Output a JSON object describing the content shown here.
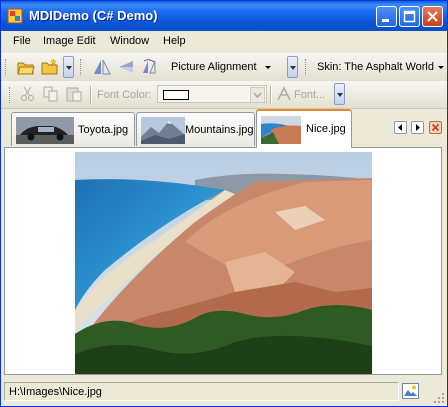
{
  "window": {
    "title": "MDIDemo (C# Demo)"
  },
  "menu": [
    "File",
    "Image Edit",
    "Window",
    "Help"
  ],
  "toolbar1": {
    "picture_alignment": "Picture Alignment",
    "skin": "Skin: The Asphalt World"
  },
  "toolbar2": {
    "font_color_label": "Font Color:",
    "font_button": "Font..."
  },
  "tabs": [
    {
      "label": "Toyota.jpg",
      "icon": "car-photo-thumbnail",
      "active": false
    },
    {
      "label": "Mountains.jpg",
      "icon": "mountains-photo-thumbnail",
      "active": false
    },
    {
      "label": "Nice.jpg",
      "icon": "nice-coast-photo-thumbnail",
      "active": true
    }
  ],
  "status": {
    "path": "H:\\Images\\Nice.jpg"
  },
  "colors": {
    "title_bar": "#0a5ce8",
    "active_tab_accent": "#e68b2c",
    "close_button": "#c8401c"
  }
}
